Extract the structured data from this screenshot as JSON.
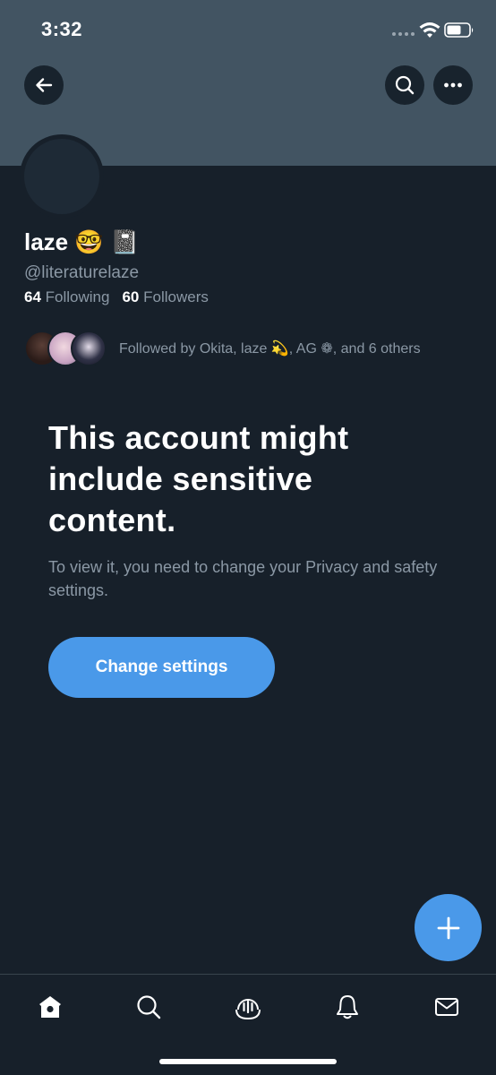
{
  "status_bar": {
    "time": "3:32"
  },
  "header": {
    "banner_color": "#425462",
    "back_icon": "arrow-left-icon",
    "search_icon": "search-icon",
    "more_icon": "more-horizontal-icon"
  },
  "profile": {
    "display_name": "laze 🤓 📓",
    "username": "@literaturelaze",
    "following_count": "64",
    "following_label": "Following",
    "followers_count": "60",
    "followers_label": "Followers",
    "followed_by": "Followed by Okita, laze 💫, AG ❁, and 6 others"
  },
  "warning": {
    "title": "This account might include sensitive content.",
    "subtitle": "To view it, you need to change your Privacy and safety settings.",
    "button_label": "Change settings"
  },
  "colors": {
    "background": "#17202a",
    "accent": "#4a99e9",
    "secondary_text": "#8b98a5"
  },
  "fab": {
    "icon": "plus-icon"
  },
  "tabbar": {
    "items": [
      "home-icon",
      "search-icon",
      "spaces-icon",
      "notifications-icon",
      "messages-icon"
    ]
  }
}
